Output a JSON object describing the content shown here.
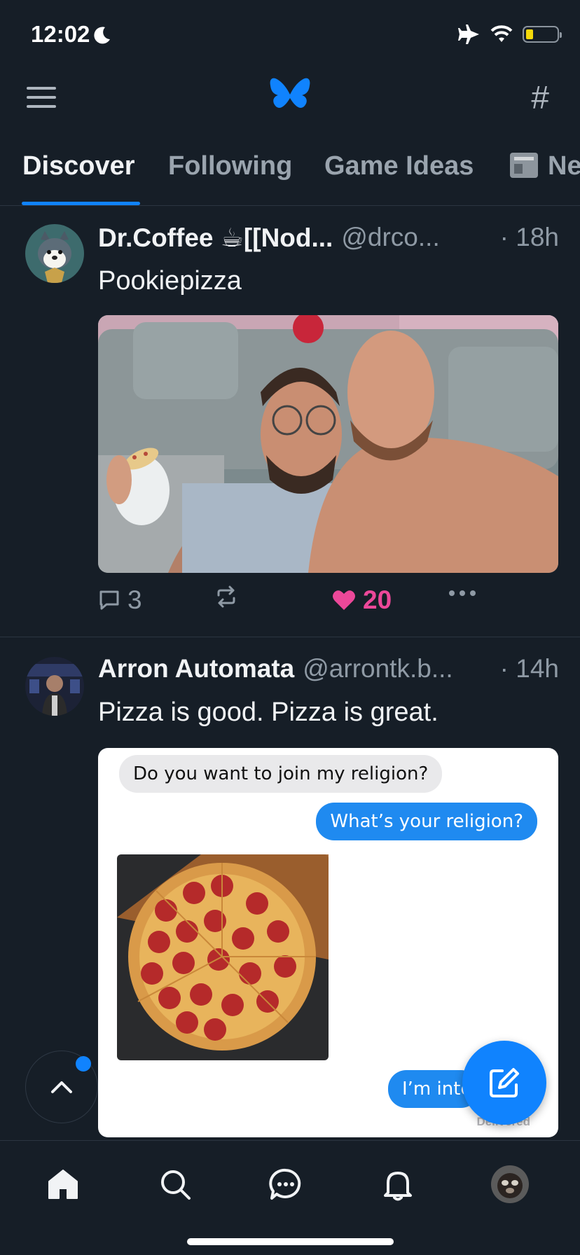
{
  "status_bar": {
    "time": "12:02"
  },
  "header": {
    "logo": "butterfly-logo",
    "feeds_icon": "#"
  },
  "tabs": [
    {
      "label": "Discover",
      "active": true
    },
    {
      "label": "Following"
    },
    {
      "label": "Game Ideas"
    },
    {
      "label": "Ne"
    }
  ],
  "posts": [
    {
      "display_name": "Dr.Coffee ☕[[Nod...",
      "handle": "@drco...",
      "time": "· 18h",
      "text": "Pookiepizza",
      "replies": "3",
      "reposts": "",
      "likes": "20"
    },
    {
      "display_name": "Arron Automata",
      "handle": "@arrontk.b...",
      "time": "· 14h",
      "text": "Pizza is good. Pizza is great.",
      "chat": {
        "incoming": "Do you want to join my religion?",
        "outgoing": "What’s your religion?",
        "reply_partial": "I’m inte",
        "delivered": "Delivered"
      }
    }
  ],
  "colors": {
    "accent": "#1083fe",
    "like": "#ec4899",
    "background": "#161e27"
  }
}
